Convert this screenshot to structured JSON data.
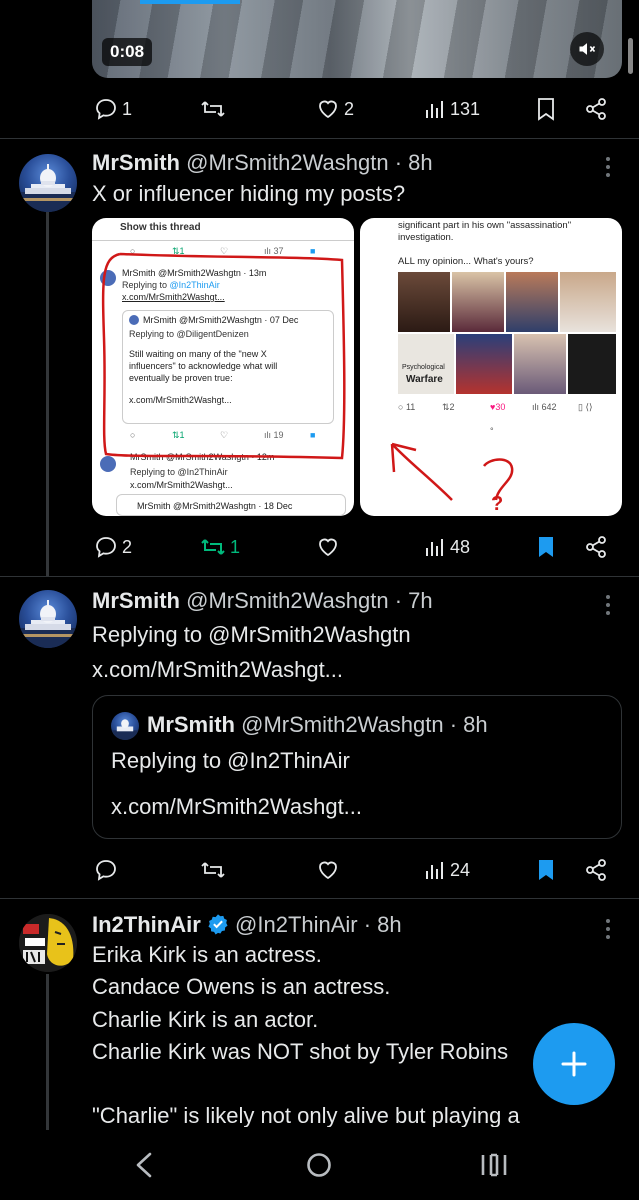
{
  "video": {
    "timestamp": "0:08"
  },
  "tweet0": {
    "replies": "1",
    "retweets": "",
    "likes": "2",
    "views": "131"
  },
  "tweet1": {
    "name": "MrSmith",
    "handle_time": "@MrSmith2Washgtn · 8h",
    "text": "X or influencer hiding my posts?",
    "replies": "2",
    "retweets": "1",
    "likes": "",
    "views": "48",
    "img_left": {
      "show_thread": "Show this thread",
      "top_retweets": "1",
      "top_views": "37",
      "reply_header": "MrSmith @MrSmith2Washgtn · 13m",
      "reply_to_label": "Replying to ",
      "reply_to_handle": "@In2ThinAir",
      "reply_link": "x.com/MrSmith2Washgt...",
      "quote_header": "MrSmith @MrSmith2Washgtn · 07 Dec",
      "quote_reply_to": "Replying to @DiligentDenizen",
      "quote_line1": "Still waiting on many of the \"new X",
      "quote_line2": "influencers\" to acknowledge what will",
      "quote_line3": "eventually be proven true:",
      "quote_link": "x.com/MrSmith2Washgt...",
      "mid_retweets": "1",
      "mid_views": "19",
      "reply2_header": "MrSmith @MrSmith2Washgtn · 12m",
      "reply2_to": "Replying to @In2ThinAir",
      "reply2_link": "x.com/MrSmith2Washgt...",
      "reply3_header": "MrSmith @MrSmith2Washgtn · 18 Dec"
    },
    "img_right": {
      "line1": "significant part in his own \"assassination\"",
      "line2": "investigation.",
      "line3": "ALL my opinion... What's yours?",
      "caption_top": "Psychological",
      "caption_bottom": "Warfare",
      "replies": "11",
      "retweets": "2",
      "likes": "30",
      "views": "642",
      "question_mark": "?"
    }
  },
  "tweet2": {
    "name": "MrSmith",
    "handle_time": "@MrSmith2Washgtn · 7h",
    "reply_line": "Replying to @MrSmith2Washgtn",
    "link": "x.com/MrSmith2Washgt...",
    "quote": {
      "name": "MrSmith",
      "handle_time": "@MrSmith2Washgtn · 8h",
      "reply_line": "Replying to @In2ThinAir",
      "link": "x.com/MrSmith2Washgt..."
    },
    "replies": "",
    "retweets": "",
    "likes": "",
    "views": "24"
  },
  "tweet3": {
    "name": "In2ThinAir",
    "handle_time": "@In2ThinAir · 8h",
    "line1": "Erika Kirk is an actress.",
    "line2": "Candace Owens is an actress.",
    "line3": "Charlie Kirk is an actor.",
    "line4": "Charlie Kirk was NOT shot by Tyler Robins",
    "line5": "\"Charlie\" is likely not only alive but playing a"
  },
  "colors": {
    "accent": "#1d9bf0",
    "retweet_active": "#00ba7c",
    "background": "#000000",
    "like_active": "#f91880"
  }
}
